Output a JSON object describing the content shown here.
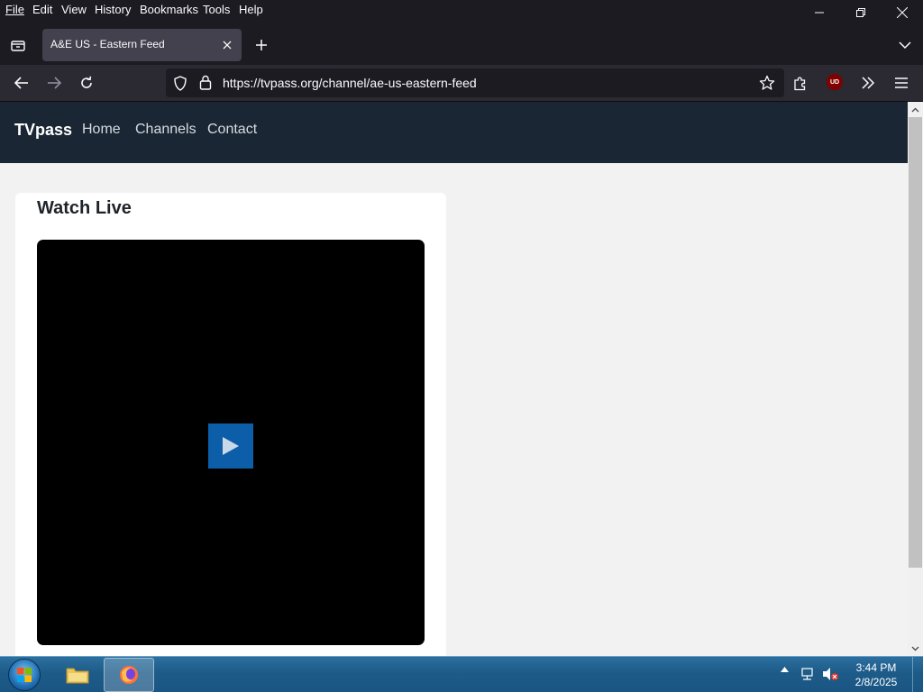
{
  "browser": {
    "menu": [
      {
        "label": "File"
      },
      {
        "label": "Edit"
      },
      {
        "label": "View"
      },
      {
        "label": "History"
      },
      {
        "label": "Bookmarks"
      },
      {
        "label": "Tools"
      },
      {
        "label": "Help"
      }
    ],
    "tab_title": "A&E US - Eastern Feed",
    "url": "https://tvpass.org/channel/ae-us-eastern-feed",
    "ublock_badge": "UD"
  },
  "site": {
    "brand": "TVpass",
    "nav": [
      "Home",
      "Channels",
      "Contact"
    ],
    "card_title": "Watch Live"
  },
  "taskbar": {
    "time": "3:44 PM",
    "date": "2/8/2025"
  },
  "colors": {
    "site_nav_bg": "#1a2633",
    "play_button": "#0c5ea8",
    "page_bg": "#f2f2f2"
  }
}
